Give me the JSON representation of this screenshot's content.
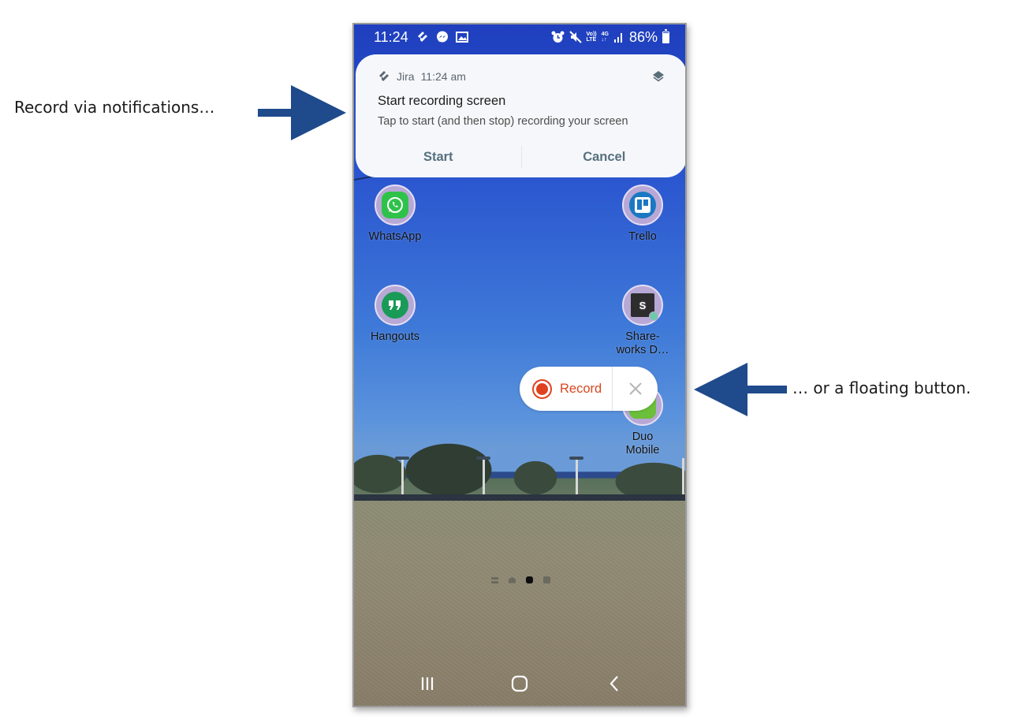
{
  "annotations": {
    "left_caption": "Record via notifications…",
    "right_caption": "… or a floating button.",
    "arrow_color": "#1f4a8c"
  },
  "status_bar": {
    "time": "11:24",
    "left_icons": [
      "jira-icon",
      "messenger-icon",
      "gallery-icon"
    ],
    "right_icons": [
      "alarm-icon",
      "mute-icon",
      "volte-icon",
      "4g-icon",
      "signal-icon"
    ],
    "volte_top": "Vo))",
    "volte_bottom": "LTE",
    "network_top": "4G",
    "network_bottom": "↓↑",
    "battery_percent": "86%",
    "battery_level": 0.86
  },
  "notification": {
    "app_name": "Jira",
    "time": "11:24 am",
    "title": "Start recording screen",
    "body": "Tap to start (and then stop) recording your screen",
    "actions": [
      {
        "label": "Start"
      },
      {
        "label": "Cancel"
      }
    ]
  },
  "home_screen": {
    "apps": [
      {
        "name": "WhatsApp",
        "icon": "whatsapp-icon",
        "color": "#2fc24a"
      },
      {
        "name": "Trello",
        "icon": "trello-icon",
        "color": "#1a78c2"
      },
      {
        "name": "Hangouts",
        "icon": "hangouts-icon",
        "color": "#1a9a57"
      },
      {
        "name": "Share-\nworks D…",
        "icon": "shareworks-icon",
        "color": "#2d2d2d",
        "glyph": "S"
      },
      {
        "name": "Duo\nMobile",
        "icon": "duo-mobile-icon",
        "color": "#6bbf3a"
      }
    ],
    "page_count": 4,
    "active_page": 3
  },
  "floating_button": {
    "label": "Record",
    "accent": "#e0421f"
  },
  "nav_bar": {
    "buttons": [
      "recents",
      "home",
      "back"
    ]
  }
}
